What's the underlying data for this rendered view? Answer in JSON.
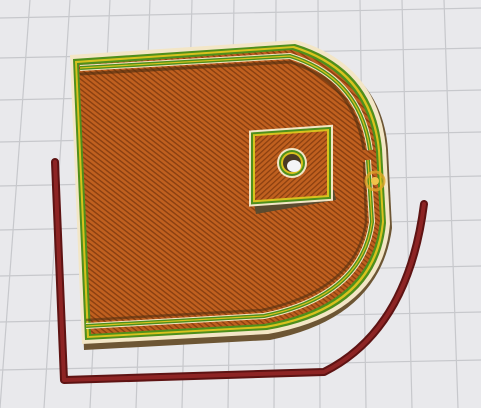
{
  "scene": {
    "description_visible_text": [],
    "colors": {
      "background": "#e9e9ec",
      "grid_line": "#c7c8cc",
      "infill": "#b85a1d",
      "infill_hatch": "#8a3f10",
      "perimeter_outer": "#f3e6c6",
      "perimeter_green": "#4f8f1c",
      "perimeter_yellow": "#d8c21e",
      "skirt": "#7b1c1c",
      "side_shadow": "#5b4b2f",
      "seam_marker": "#e0a52a"
    },
    "objects": {
      "build_plate_grid": "build-plate-grid",
      "print_layer": "g-code-layer-preview",
      "skirt": "skirt-outline",
      "square_boss": "square-boss-with-hole",
      "seam": "z-seam-marker-icon"
    }
  }
}
